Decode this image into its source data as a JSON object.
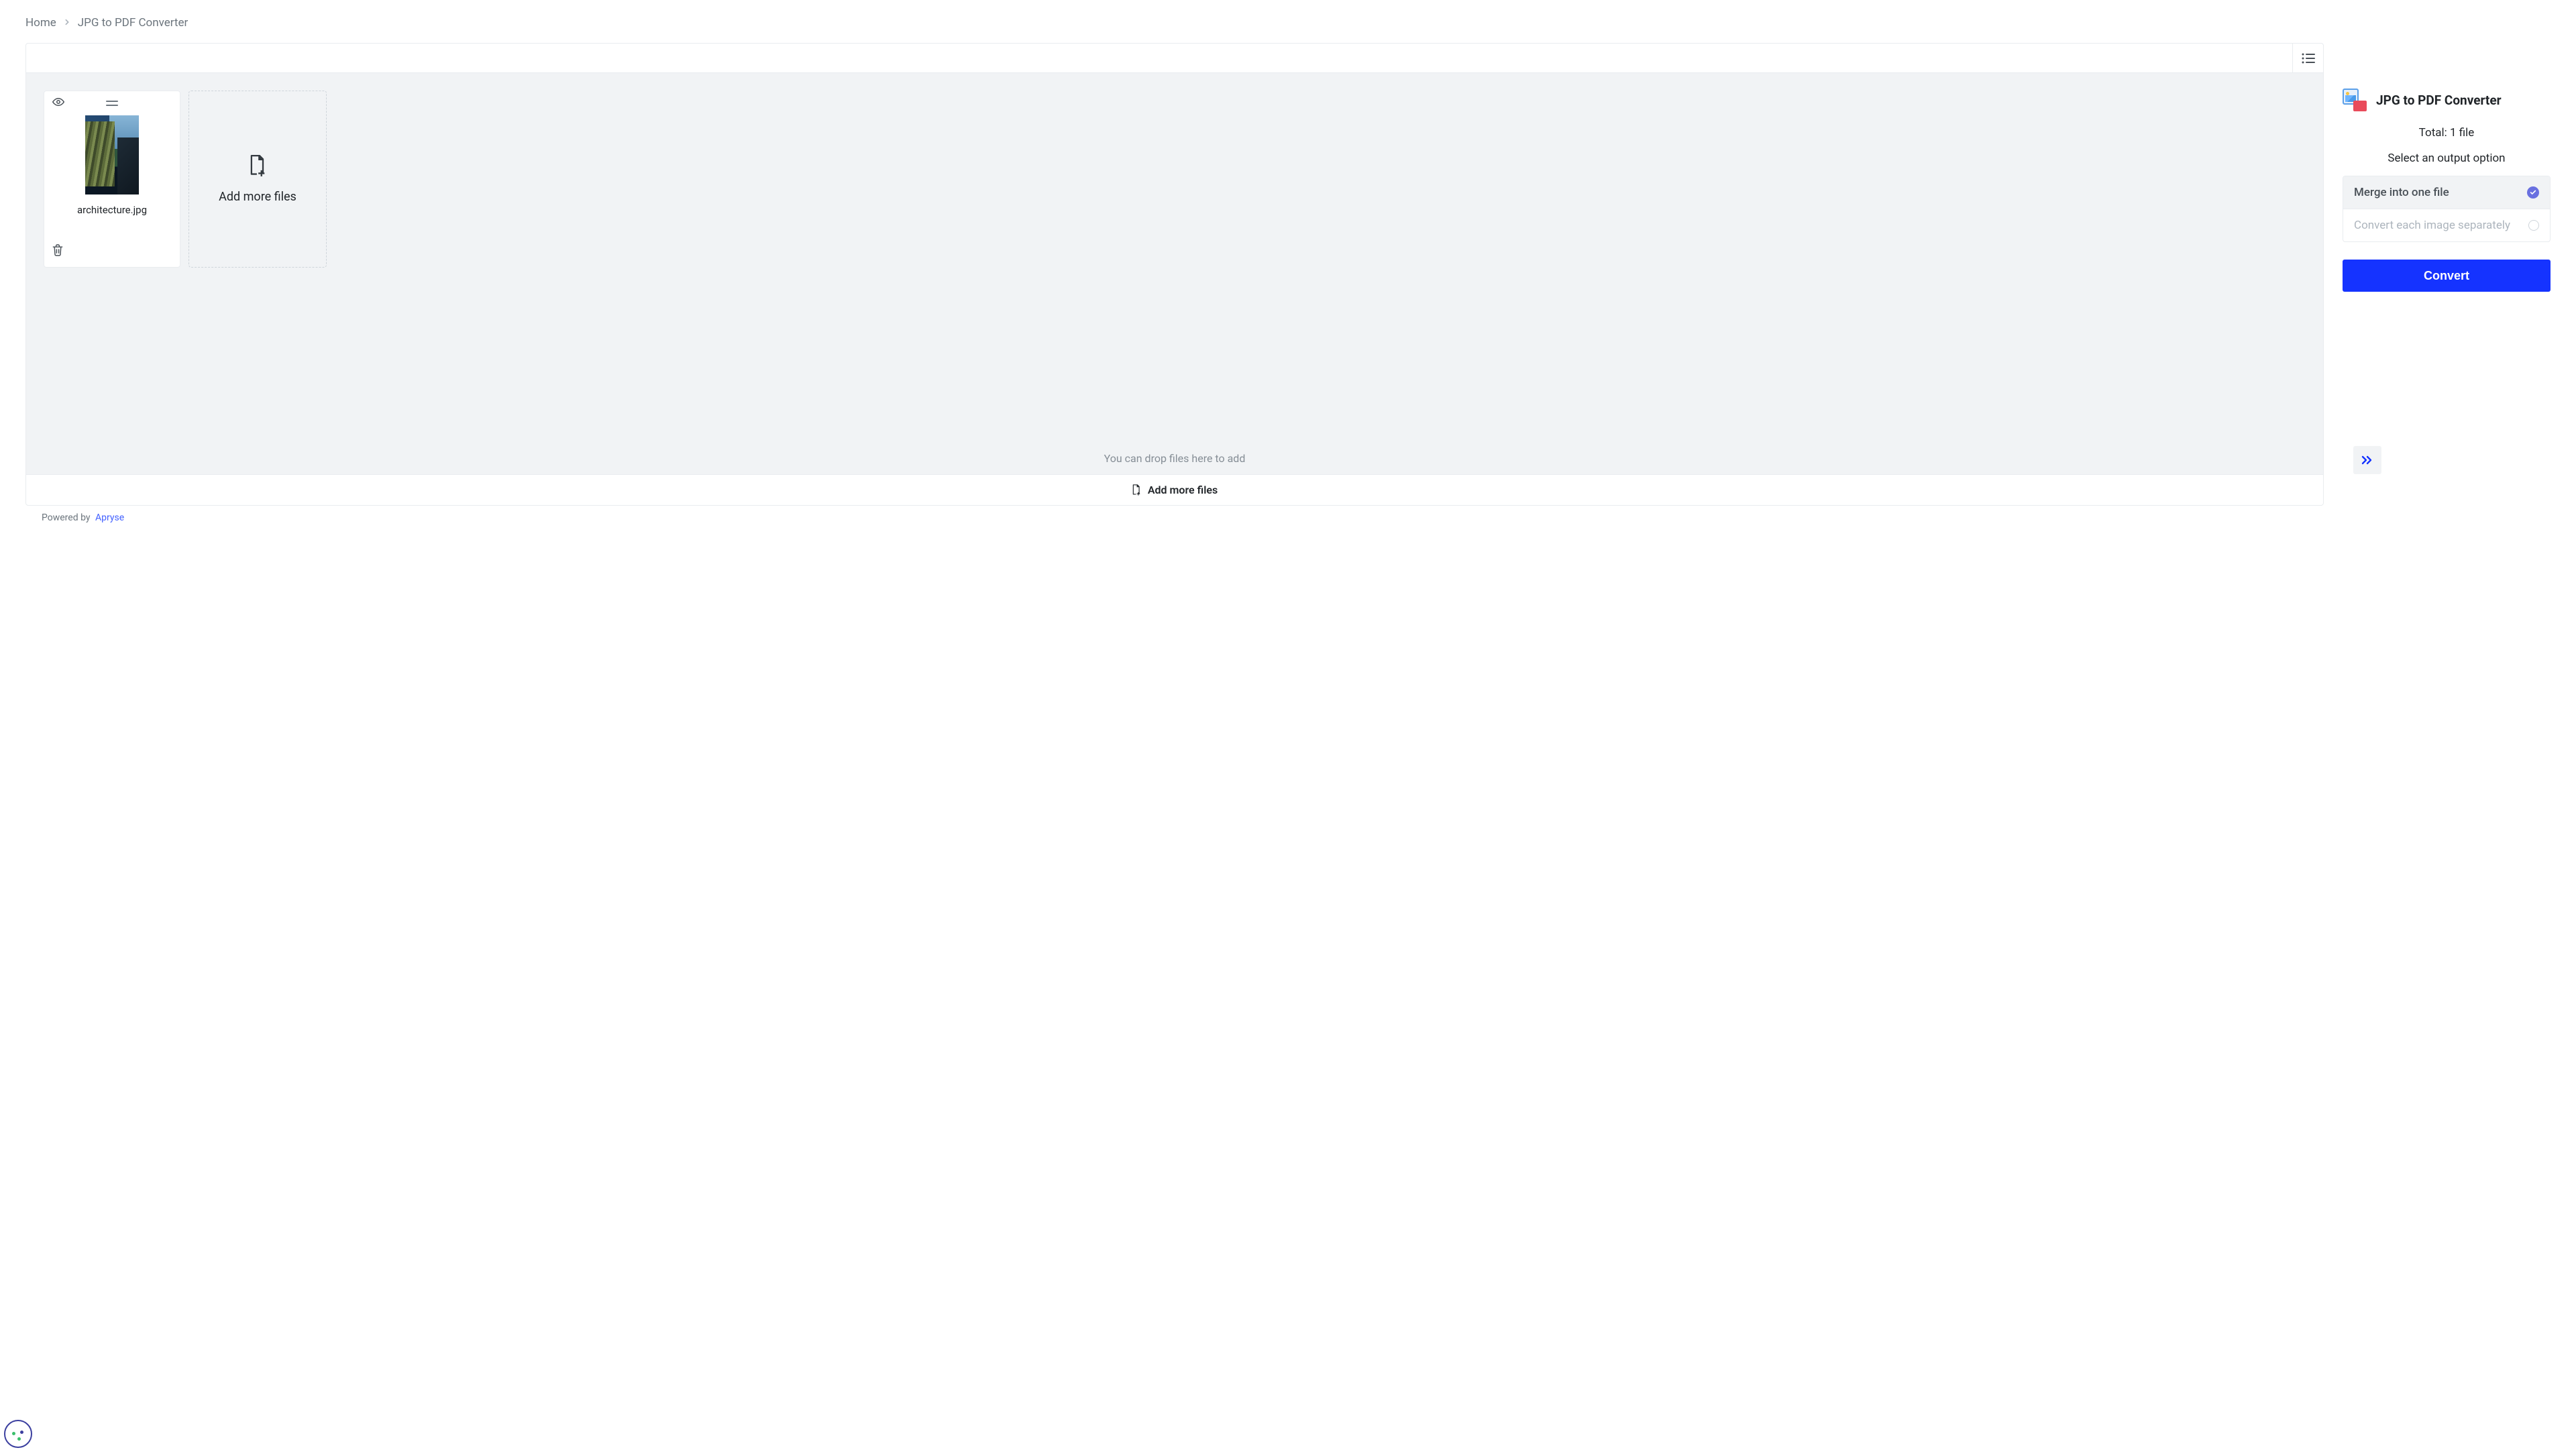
{
  "breadcrumb": {
    "home": "Home",
    "current": "JPG to PDF Converter"
  },
  "file": {
    "name": "architecture.jpg"
  },
  "workspace": {
    "addMore": "Add more files",
    "dropHint": "You can drop files here to add"
  },
  "bottomBar": {
    "label": "Add more files"
  },
  "side": {
    "title": "JPG to PDF Converter",
    "total": "Total: 1 file",
    "instruction": "Select an output option",
    "option1": "Merge into one file",
    "option2": "Convert each image separately",
    "convert": "Convert"
  },
  "footer": {
    "text": "Powered by",
    "link": "Apryse"
  }
}
